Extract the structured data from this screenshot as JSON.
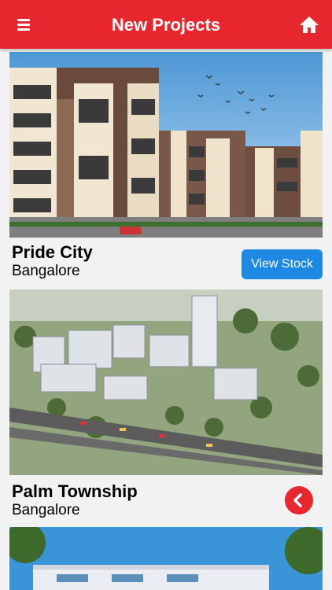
{
  "header": {
    "title": "New Projects",
    "menu_icon": "hamburger-menu-icon",
    "home_icon": "home-icon"
  },
  "projects": [
    {
      "name": "Pride City",
      "location": "Bangalore",
      "action_label": "View Stock"
    },
    {
      "name": "Palm Township",
      "location": "Bangalore",
      "action_icon": "chevron-left-icon"
    }
  ],
  "colors": {
    "primary": "#e8262d",
    "accent": "#1e88e5"
  }
}
